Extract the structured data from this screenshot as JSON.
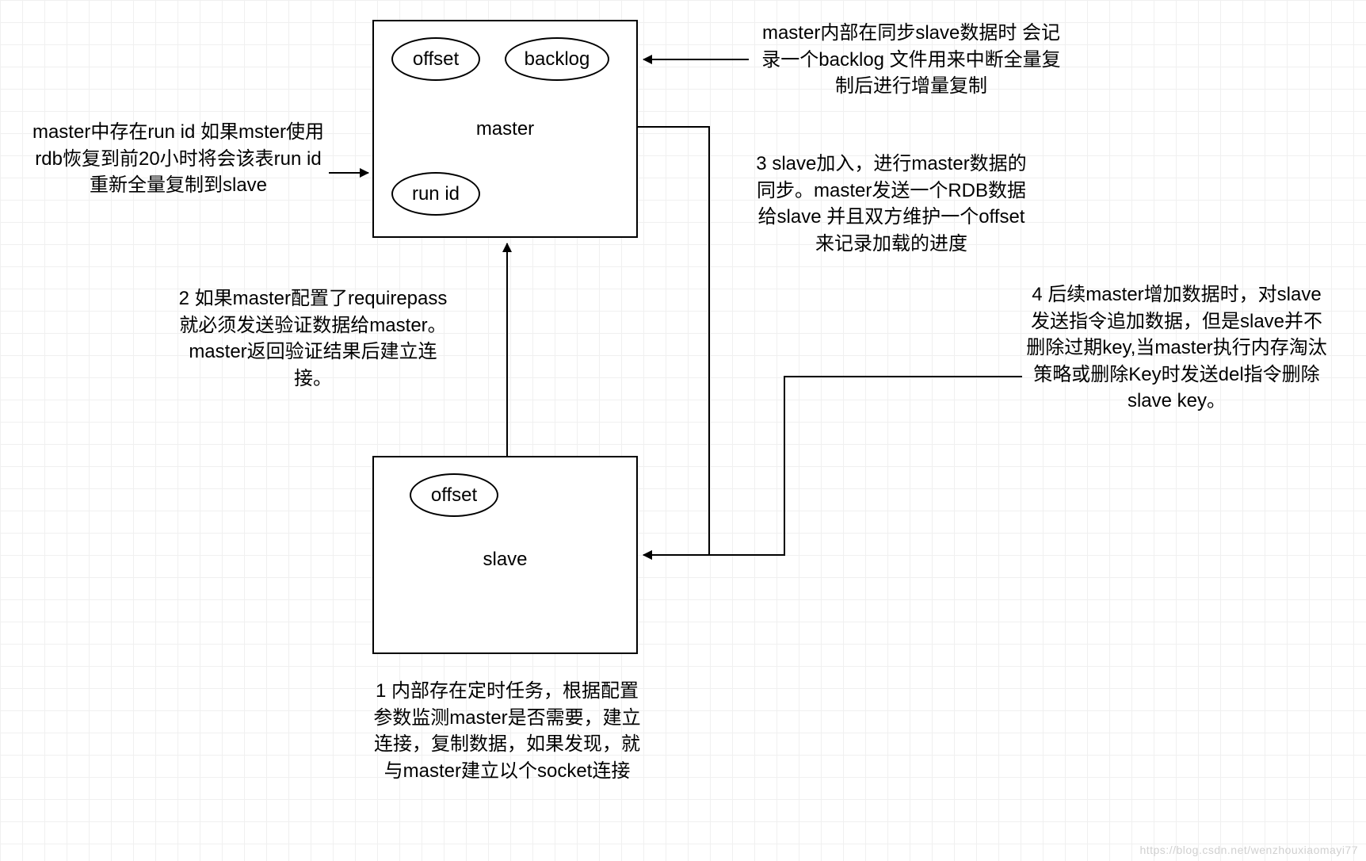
{
  "nodes": {
    "master": {
      "title": "master",
      "items": {
        "offset": "offset",
        "backlog": "backlog",
        "runid": "run id"
      }
    },
    "slave": {
      "title": "slave",
      "items": {
        "offset": "offset"
      }
    }
  },
  "annotations": {
    "left_runid": "master中存在run id 如果mster使用rdb恢复到前20小时将会该表run id 重新全量复制到slave",
    "top_backlog": "master内部在同步slave数据时  会记录一个backlog 文件用来中断全量复制后进行增量复制",
    "step1": "1   内部存在定时任务，根据配置参数监测master是否需要，建立连接，复制数据，如果发现，就与master建立以个socket连接",
    "step2": "2   如果master配置了requirepass 就必须发送验证数据给master。master返回验证结果后建立连接。",
    "step3": "3  slave加入，进行master数据的同步。master发送一个RDB数据给slave 并且双方维护一个offset来记录加载的进度",
    "step4": "4 后续master增加数据时，对slave发送指令追加数据，但是slave并不删除过期key,当master执行内存淘汰策略或删除Key时发送del指令删除slave key。"
  },
  "watermark": "https://blog.csdn.net/wenzhouxiaomayi77"
}
